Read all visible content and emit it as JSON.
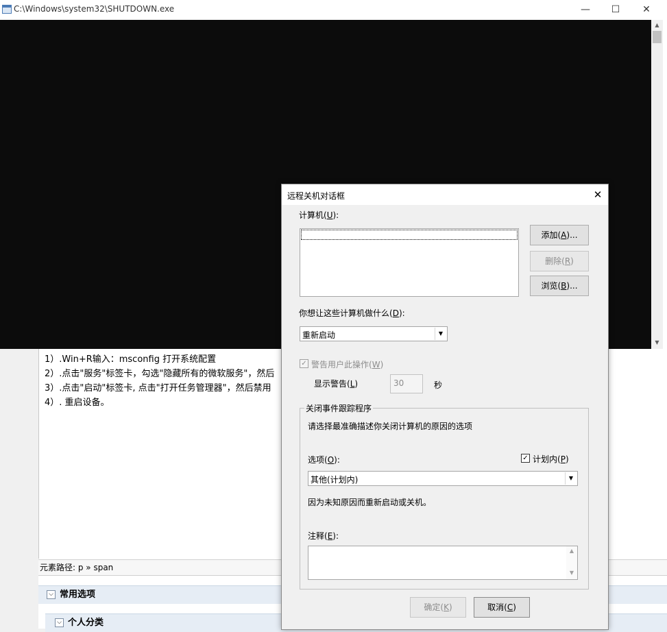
{
  "background": {
    "lines": [
      "1）.Win+R输入：msconfig 打开系统配置",
      "2）.点击\"服务\"标签卡，勾选\"隐藏所有的微软服务\"，然后",
      "3）.点击\"启动\"标签卡, 点击\"打开任务管理器\"，然后禁用",
      "4）. 重启设备。"
    ],
    "element_path": "元素路径: p » span",
    "sections": [
      "常用选项",
      "个人分类"
    ]
  },
  "console": {
    "title": "C:\\Windows\\system32\\SHUTDOWN.exe",
    "minimize_glyph": "—",
    "maximize_glyph": "☐",
    "close_glyph": "✕"
  },
  "dialog": {
    "title": "远程关机对话框",
    "close_glyph": "✕",
    "computer_label": "计算机",
    "computer_key": "U",
    "add_button": "添加",
    "add_key": "A",
    "remove_button": "删除",
    "remove_key": "R",
    "browse_button": "浏览",
    "browse_key": "B",
    "action_label": "你想让这些计算机做什么",
    "action_key": "D",
    "action_selected": "重新启动",
    "warn_checkbox": "警告用户此操作",
    "warn_key": "W",
    "warn_checked": true,
    "show_warning_label": "显示警告",
    "show_warning_key": "L",
    "warn_seconds_value": "30",
    "seconds_unit": "秒",
    "tracker_group": "关闭事件跟踪程序",
    "tracker_hint": "请选择最准确描述你关闭计算机的原因的选项",
    "option_label": "选项",
    "option_key": "O",
    "planned_checkbox": "计划内",
    "planned_key": "P",
    "planned_checked": true,
    "option_selected": "其他(计划内)",
    "reason_description": "因为未知原因而重新启动或关机。",
    "comment_label": "注释",
    "comment_key": "E",
    "comment_value": "",
    "ok_button": "确定",
    "ok_key": "K",
    "cancel_button": "取消",
    "cancel_key": "C"
  },
  "icons": {
    "check": "✓",
    "dropdown": "▼",
    "scroll_up": "▲",
    "scroll_down": "▼",
    "collapse": "⌵"
  }
}
